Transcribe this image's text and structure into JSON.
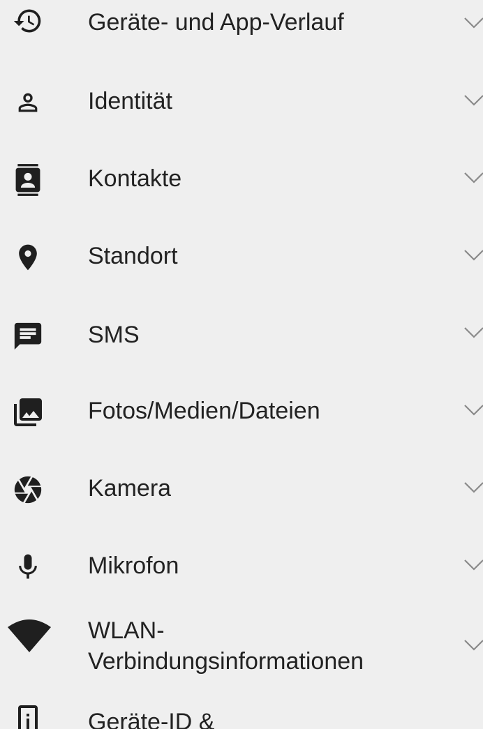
{
  "permissions": {
    "items": [
      {
        "label": "Geräte- und App-Verlauf",
        "icon": "history-icon"
      },
      {
        "label": "Identität",
        "icon": "person-icon"
      },
      {
        "label": "Kontakte",
        "icon": "contacts-icon"
      },
      {
        "label": "Standort",
        "icon": "location-pin-icon"
      },
      {
        "label": "SMS",
        "icon": "message-icon"
      },
      {
        "label": "Fotos/Medien/Dateien",
        "icon": "photo-library-icon"
      },
      {
        "label": "Kamera",
        "icon": "camera-shutter-icon"
      },
      {
        "label": "Mikrofon",
        "icon": "microphone-icon"
      },
      {
        "label_line1": "WLAN-",
        "label_line2": "Verbindungsinformationen",
        "icon": "wifi-icon"
      },
      {
        "label": "Geräte-ID &",
        "icon": "device-info-icon"
      }
    ]
  }
}
